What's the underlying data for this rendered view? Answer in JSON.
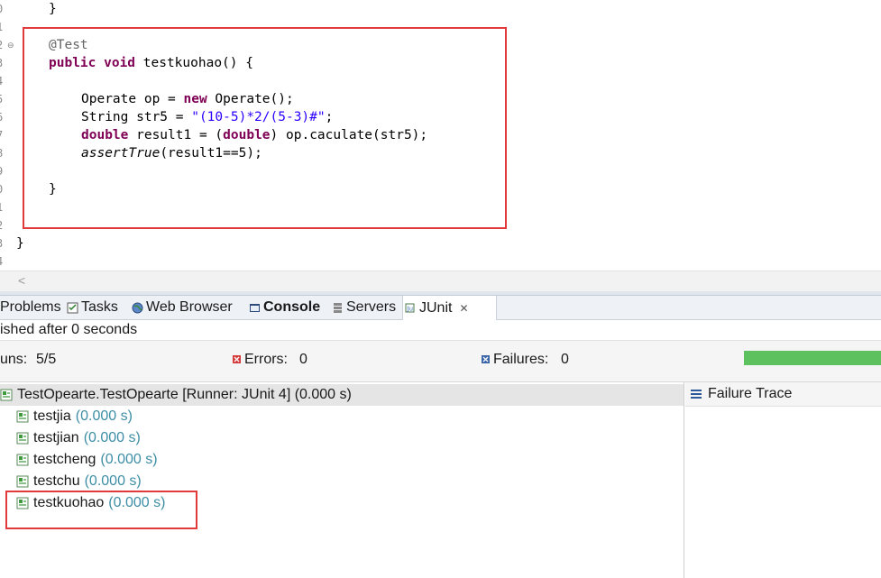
{
  "editor": {
    "line_numbers": [
      "0",
      "1",
      "2",
      "3",
      "4",
      "5",
      "6",
      "7",
      "8",
      "9",
      "0",
      "1",
      "2",
      "3",
      "4"
    ],
    "code": {
      "l0": "}",
      "annotation": "@Test",
      "sig_kw": "public void",
      "sig_rest": " testkuohao() {",
      "op_a": "Operate op = ",
      "op_kw": "new",
      "op_b": " Operate();",
      "str_a": "String str5 = ",
      "str_lit": "\"(10-5)*2/(5-3)#\"",
      "str_b": ";",
      "dbl_kw": "double",
      "dbl_a": " result1 = (",
      "dbl_kw2": "double",
      "dbl_b": ") op.caculate(str5);",
      "assert_fn": "assertTrue",
      "assert_rest": "(result1==5);",
      "close_method": "}",
      "close_class": "}"
    },
    "scroll_left_glyph": "<"
  },
  "tabs": [
    {
      "label": "Problems",
      "icon": "problems-icon"
    },
    {
      "label": "Tasks",
      "icon": "tasks-icon"
    },
    {
      "label": "Web Browser",
      "icon": "globe-icon"
    },
    {
      "label": "Console",
      "icon": "console-icon"
    },
    {
      "label": "Servers",
      "icon": "servers-icon"
    },
    {
      "label": "JUnit",
      "icon": "junit-icon",
      "close": "✕"
    }
  ],
  "junit": {
    "status": "ished after 0 seconds",
    "runs_label": "uns:",
    "runs_value": "5/5",
    "errors_label": "Errors:",
    "errors_value": "0",
    "failures_label": "Failures:",
    "failures_value": "0",
    "progress": 1.0,
    "bar_color": "#5dc25d",
    "root": {
      "label": "TestOpearte.TestOpearte [Runner: JUnit 4] (0.000 s)"
    },
    "tests": [
      {
        "name": "testjia",
        "time": "(0.000 s)"
      },
      {
        "name": "testjian",
        "time": "(0.000 s)"
      },
      {
        "name": "testcheng",
        "time": "(0.000 s)"
      },
      {
        "name": "testchu",
        "time": "(0.000 s)"
      },
      {
        "name": "testkuohao",
        "time": "(0.000 s)"
      }
    ],
    "failure_trace_label": "Failure Trace"
  },
  "colors": {
    "keyword": "#7f0055",
    "string": "#2a00ff",
    "annotation": "#646464",
    "highlight_box": "#e23a3a",
    "time_text": "#3d8ea5"
  }
}
